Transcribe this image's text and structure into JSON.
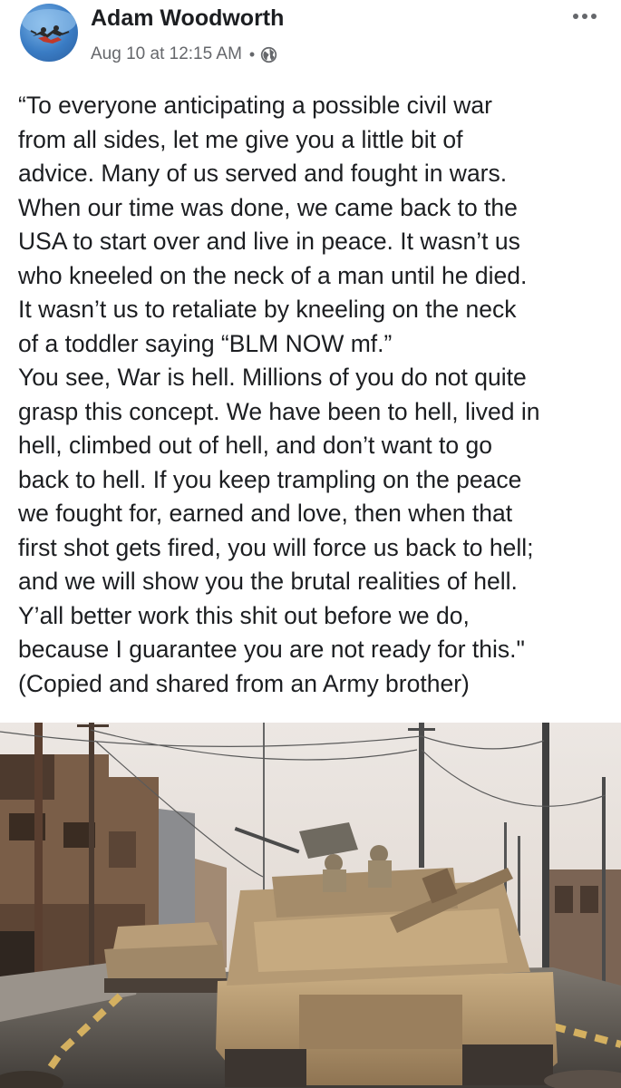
{
  "post": {
    "author": "Adam Woodworth",
    "timestamp": "Aug 10 at 12:15 AM",
    "separator": "•",
    "audience_icon": "globe-icon",
    "more_icon": "more-dots-icon",
    "text": "“To everyone anticipating a possible civil war\nfrom all sides, let me give you a little bit of\nadvice. Many of us served and fought in wars.\nWhen our time was done, we came back to the\nUSA to start over and live in peace. It wasn’t us\nwho kneeled on the neck of a man until he died.\nIt wasn’t us to retaliate by kneeling on the neck\nof a toddler saying “BLM NOW mf.”\nYou see, War is hell. Millions of you do not quite\ngrasp this concept. We have been to hell, lived in\nhell, climbed out of hell, and don’t want to go\nback to hell. If you keep trampling on the peace\nwe fought for, earned and love, then when that\nfirst shot gets fired, you will force us back to hell;\nand we will show you the brutal realities of hell.\nY’all better work this shit out before we do,\nbecause I guarantee you are not ready for this.\"\n(Copied and shared from an Army brother)"
  },
  "colors": {
    "text": "#1c1e21",
    "secondary_text": "#65676b",
    "background": "#ffffff"
  }
}
